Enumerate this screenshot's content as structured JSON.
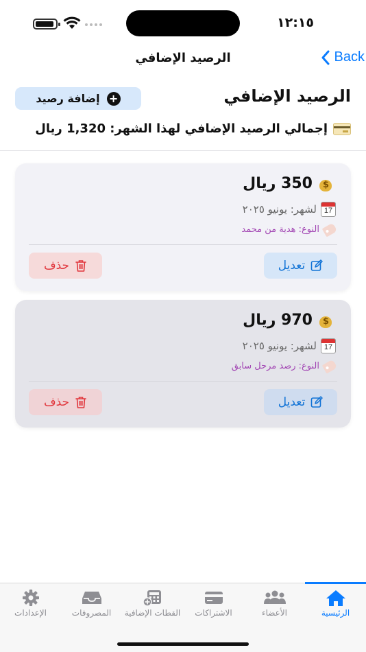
{
  "status": {
    "time": "١٢:١٥"
  },
  "nav": {
    "back_label": "Back",
    "title": "الرصيد الإضافي"
  },
  "header": {
    "title": "الرصيد الإضافي",
    "add_button_label": "إضافة رصيد",
    "total_text": "إجمالي الرصيد الإضافي لهذا الشهر: 1,320 ريال"
  },
  "cards": [
    {
      "amount": "350 ريال",
      "month": "لشهر: يونيو ٢٠٢٥",
      "type": "النوع: هدية من محمد",
      "edit_label": "تعديل",
      "delete_label": "حذف"
    },
    {
      "amount": "970 ريال",
      "month": "لشهر: يونيو ٢٠٢٥",
      "type": "النوع: رصد مرحل سابق",
      "edit_label": "تعديل",
      "delete_label": "حذف"
    }
  ],
  "calendar_day": "17",
  "tabs": [
    {
      "label": "الرئيسية",
      "icon": "home-icon",
      "active": true
    },
    {
      "label": "الأعضاء",
      "icon": "people-icon",
      "active": false
    },
    {
      "label": "الاشتراكات",
      "icon": "credit-card-icon",
      "active": false
    },
    {
      "label": "القطات الإضافية",
      "icon": "calculator-icon",
      "active": false
    },
    {
      "label": "المصروفات",
      "icon": "tray-icon",
      "active": false
    },
    {
      "label": "الإعدادات",
      "icon": "gear-icon",
      "active": false
    }
  ],
  "colors": {
    "accent": "#0a7cff",
    "delete": "#e1363c",
    "type_text": "#a348b4"
  }
}
